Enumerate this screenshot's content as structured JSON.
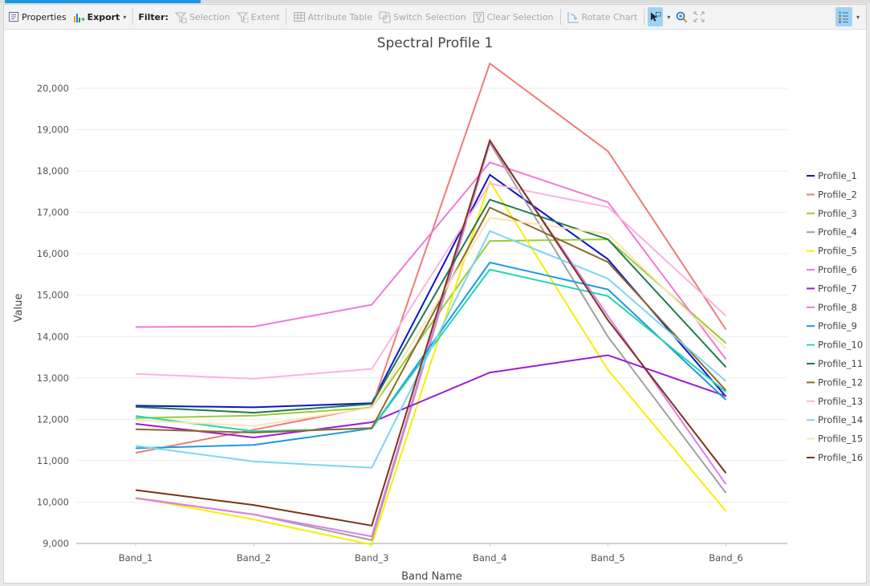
{
  "toolbar": {
    "properties_label": "Properties",
    "export_label": "Export",
    "filter_label": "Filter:",
    "selection_label": "Selection",
    "extent_label": "Extent",
    "attribute_table_label": "Attribute Table",
    "switch_selection_label": "Switch Selection",
    "clear_selection_label": "Clear Selection",
    "rotate_chart_label": "Rotate Chart",
    "select_tool_icon": "select-pointer-icon",
    "zoom_icon": "zoom-in-icon",
    "full_extent_icon": "full-extent-icon",
    "legend_toggle_icon": "legend-list-icon"
  },
  "colors": {
    "tab_accent": "#1c97e0",
    "toggle_on": "#9fd3f5"
  },
  "chart_data": {
    "type": "line",
    "title": "Spectral Profile 1",
    "xlabel": "Band Name",
    "ylabel": "Value",
    "categories": [
      "Band_1",
      "Band_2",
      "Band_3",
      "Band_4",
      "Band_5",
      "Band_6"
    ],
    "ylim": [
      9000,
      20700
    ],
    "yticks": [
      9000,
      10000,
      11000,
      12000,
      13000,
      14000,
      15000,
      16000,
      17000,
      18000,
      19000,
      20000
    ],
    "ytick_labels": [
      "9,000",
      "10,000",
      "11,000",
      "12,000",
      "13,000",
      "14,000",
      "15,000",
      "16,000",
      "17,000",
      "18,000",
      "19,000",
      "20,000"
    ],
    "grid": true,
    "legend_position": "right",
    "series": [
      {
        "name": "Profile_1",
        "color": "#0a14c8",
        "values": [
          12330,
          12290,
          12390,
          17910,
          15870,
          12550
        ]
      },
      {
        "name": "Profile_2",
        "color": "#f07a7a",
        "values": [
          11190,
          11750,
          12300,
          20600,
          18480,
          14170
        ]
      },
      {
        "name": "Profile_3",
        "color": "#9acd32",
        "values": [
          12030,
          12090,
          12280,
          16310,
          16350,
          13840
        ]
      },
      {
        "name": "Profile_4",
        "color": "#a0a0a0",
        "values": [
          10100,
          9700,
          9080,
          18680,
          14000,
          10220
        ]
      },
      {
        "name": "Profile_5",
        "color": "#f5f000",
        "values": [
          10110,
          9580,
          8970,
          17750,
          13200,
          9780
        ]
      },
      {
        "name": "Profile_6",
        "color": "#e07ce8",
        "values": [
          10090,
          9700,
          9170,
          18700,
          14500,
          10430
        ]
      },
      {
        "name": "Profile_7",
        "color": "#9b1cd6",
        "values": [
          11890,
          11560,
          11930,
          13130,
          13550,
          12560
        ]
      },
      {
        "name": "Profile_8",
        "color": "#f07ad8",
        "values": [
          14230,
          14240,
          14770,
          18210,
          17250,
          13450
        ]
      },
      {
        "name": "Profile_9",
        "color": "#1e9ae0",
        "values": [
          11300,
          11380,
          11780,
          15790,
          15140,
          12470
        ]
      },
      {
        "name": "Profile_10",
        "color": "#22d6b0",
        "values": [
          12080,
          11710,
          11780,
          15620,
          14980,
          12660
        ]
      },
      {
        "name": "Profile_11",
        "color": "#1e7a50",
        "values": [
          12300,
          12160,
          12370,
          17310,
          16350,
          13260
        ]
      },
      {
        "name": "Profile_12",
        "color": "#8b6a2a",
        "values": [
          11760,
          11680,
          11790,
          17120,
          15800,
          12700
        ]
      },
      {
        "name": "Profile_13",
        "color": "#f8b4e0",
        "values": [
          13100,
          12980,
          13220,
          17700,
          17130,
          14500
        ]
      },
      {
        "name": "Profile_14",
        "color": "#7cd6f0",
        "values": [
          11360,
          10980,
          10830,
          16550,
          15400,
          12920
        ]
      },
      {
        "name": "Profile_15",
        "color": "#fce4b0",
        "values": [
          11980,
          11840,
          12280,
          16870,
          16480,
          13710
        ]
      },
      {
        "name": "Profile_16",
        "color": "#7a3418",
        "values": [
          10290,
          9930,
          9430,
          18740,
          14400,
          10700
        ]
      }
    ]
  }
}
